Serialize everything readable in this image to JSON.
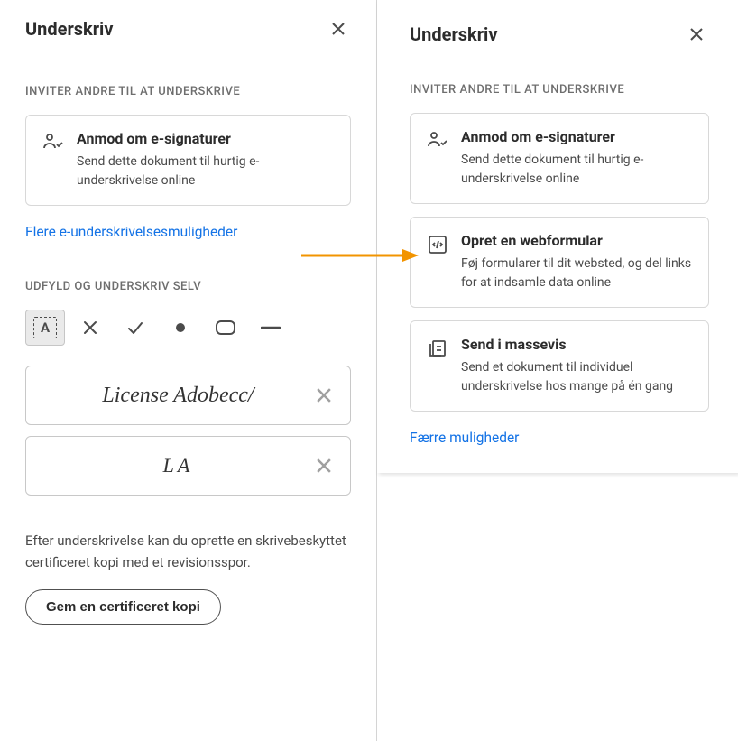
{
  "left": {
    "title": "Underskriv",
    "section_invite_others": "INVITER ANDRE TIL AT UNDERSKRIVE",
    "card_request": {
      "title": "Anmod om e-signaturer",
      "desc": "Send dette dokument til hurtig e-underskrivelse online"
    },
    "more_link": "Flere e-underskrivelsesmuligheder",
    "section_fill_self": "UDFYLD OG UNDERSKRIV SELV",
    "toolbar_text_glyph": "A",
    "signature_text": "License Adobecc/",
    "initials_text": "LA",
    "footer_note": "Efter underskrivelse kan du oprette en skrivebeskyttet certificeret kopi med et revisionsspor.",
    "certified_btn": "Gem en certificeret kopi"
  },
  "right": {
    "title": "Underskriv",
    "section_invite_others": "INVITER ANDRE TIL AT UNDERSKRIVE",
    "cards": [
      {
        "title": "Anmod om e-signaturer",
        "desc": "Send dette dokument til hurtig e-underskrivelse online"
      },
      {
        "title": "Opret en webformular",
        "desc": "Føj formularer til dit websted, og del links for at indsamle data online"
      },
      {
        "title": "Send i massevis",
        "desc": "Send et dokument til individuel underskrivelse hos mange på én gang"
      }
    ],
    "fewer_link": "Færre muligheder"
  },
  "icons": {
    "request_sig": "people-sign-icon",
    "webform": "code-form-icon",
    "bulk": "stack-send-icon",
    "close": "close-icon",
    "text_tool": "text-icon",
    "x_tool": "x-icon",
    "check_tool": "check-icon",
    "dot_tool": "dot-icon",
    "rect_tool": "rect-icon",
    "line_tool": "line-icon"
  }
}
